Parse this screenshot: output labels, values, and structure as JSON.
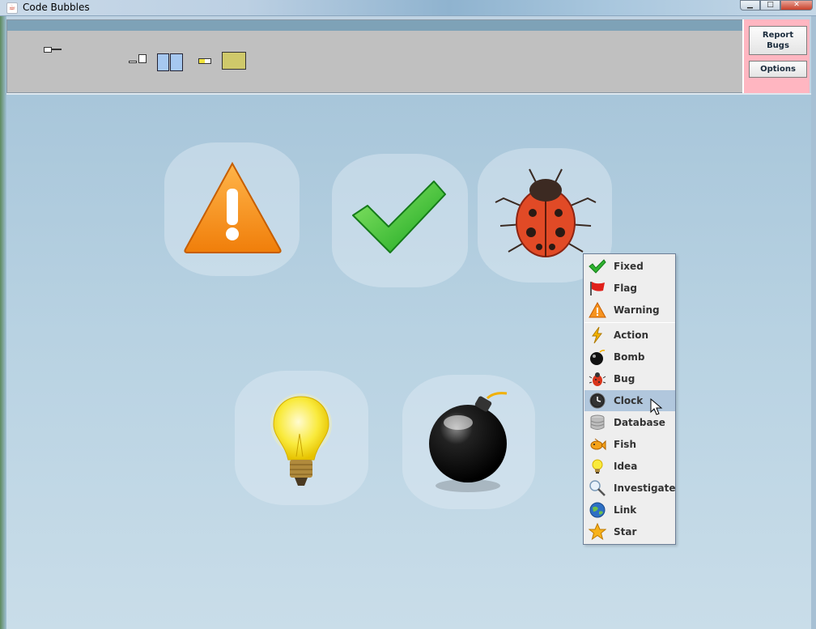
{
  "window": {
    "title": "Code Bubbles",
    "min_label": "▁",
    "max_label": "□",
    "close_label": "✕"
  },
  "side_panel": {
    "report_label": "Report Bugs",
    "options_label": "Options"
  },
  "canvas_icons": [
    "warning-icon",
    "fixed-icon",
    "bug-icon",
    "idea-icon",
    "bomb-icon"
  ],
  "menu": {
    "groups": [
      [
        {
          "label": "Fixed",
          "icon": "check-icon"
        },
        {
          "label": "Flag",
          "icon": "flag-icon"
        },
        {
          "label": "Warning",
          "icon": "warning-icon"
        }
      ],
      [
        {
          "label": "Action",
          "icon": "lightning-icon"
        },
        {
          "label": "Bomb",
          "icon": "bomb-icon"
        },
        {
          "label": "Bug",
          "icon": "bug-icon"
        },
        {
          "label": "Clock",
          "icon": "clock-icon",
          "selected": true
        },
        {
          "label": "Database",
          "icon": "database-icon"
        },
        {
          "label": "Fish",
          "icon": "fish-icon"
        },
        {
          "label": "Idea",
          "icon": "idea-icon"
        },
        {
          "label": "Investigate",
          "icon": "magnifier-icon"
        },
        {
          "label": "Link",
          "icon": "globe-icon"
        },
        {
          "label": "Star",
          "icon": "star-icon"
        }
      ]
    ]
  },
  "colors": {
    "highlight": "#b1c7dd",
    "side_panel": "#ffb6c1",
    "top_panel": "#c0c0c0"
  }
}
